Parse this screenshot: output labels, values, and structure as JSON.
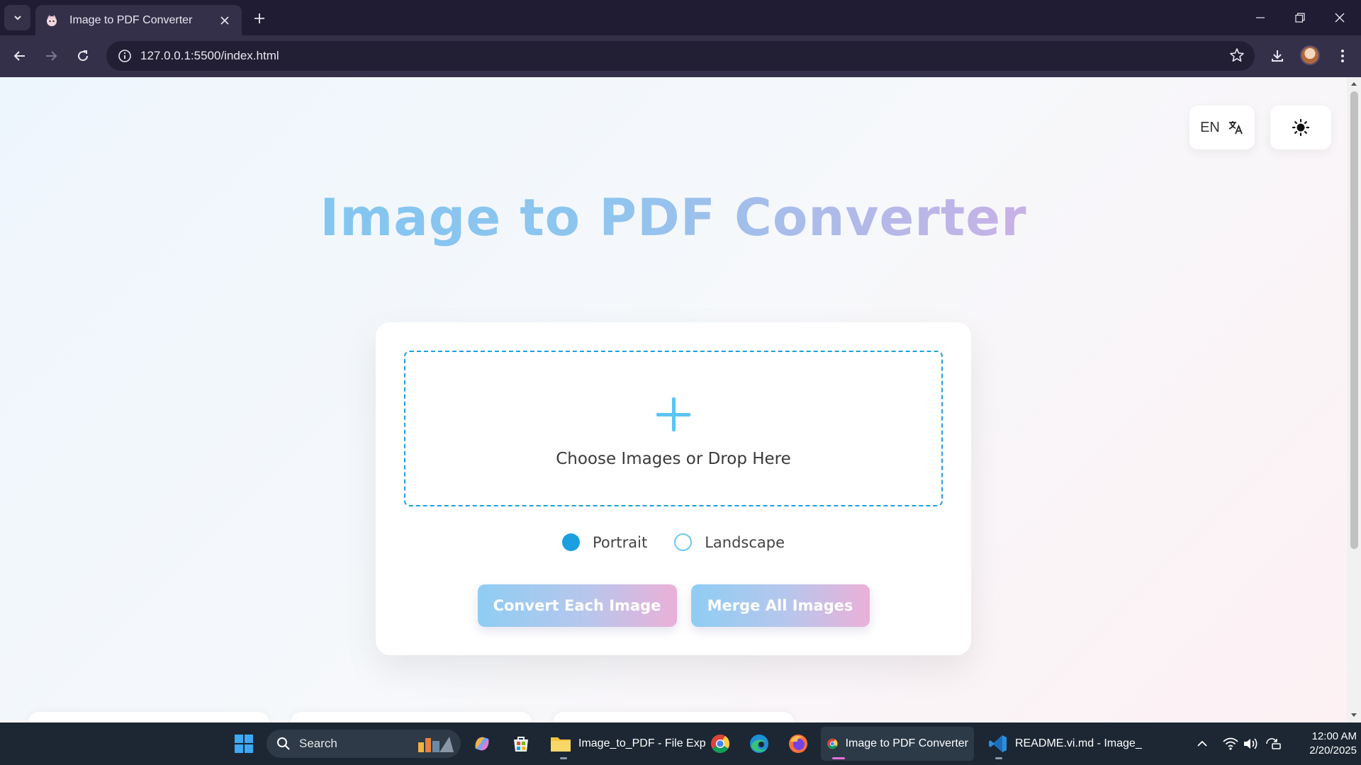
{
  "browser": {
    "tab": {
      "title": "Image to PDF Converter"
    },
    "url": "127.0.0.1:5500/index.html"
  },
  "page": {
    "language_label": "EN",
    "title": "Image to PDF Converter",
    "drop_zone_text": "Choose Images or Drop Here",
    "orientation": {
      "options": [
        {
          "label": "Portrait",
          "checked": true
        },
        {
          "label": "Landscape",
          "checked": false
        }
      ]
    },
    "buttons": {
      "convert_each": "Convert Each Image",
      "merge_all": "Merge All Images"
    },
    "colors": {
      "accent": "#1aa0e0",
      "title_gradient_start": "#74c6f4",
      "title_gradient_end": "#e8b1d6"
    }
  },
  "taskbar": {
    "search_label": "Search",
    "apps": [
      {
        "label": "Image_to_PDF - File Exp",
        "icon": "folder-icon"
      },
      {
        "label": "Image to PDF Converter",
        "icon": "chrome-icon"
      },
      {
        "label": "README.vi.md - Image_",
        "icon": "vscode-icon"
      }
    ],
    "clock": {
      "time": "12:00 AM",
      "date": "2/20/2025"
    }
  }
}
